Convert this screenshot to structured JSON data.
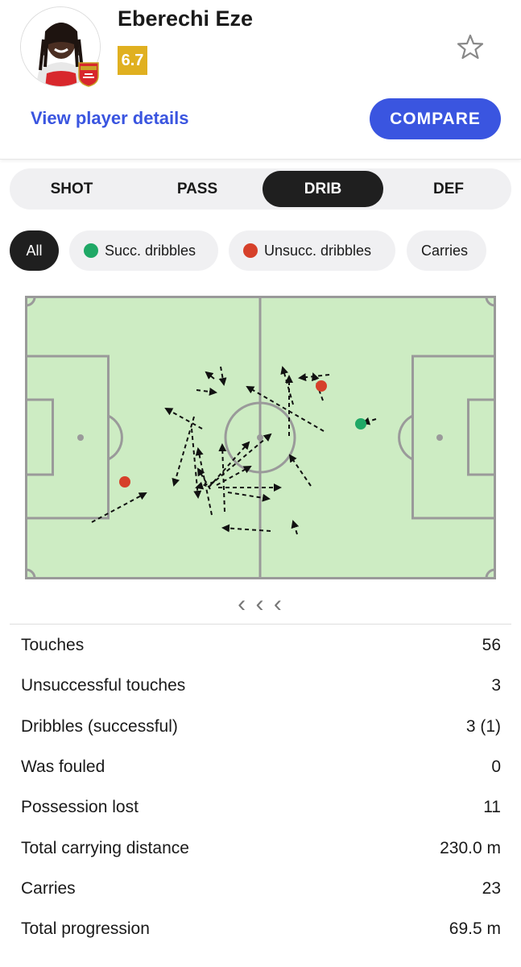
{
  "player": {
    "name": "Eberechi Eze",
    "rating": "6.7",
    "club_badge_text": "Arsenal"
  },
  "header": {
    "view_details": "View player details",
    "compare": "COMPARE"
  },
  "tabs": [
    "SHOT",
    "PASS",
    "DRIB",
    "DEF"
  ],
  "active_tab": "DRIB",
  "filters": {
    "all": "All",
    "succ": "Succ. dribbles",
    "unsucc": "Unsucc. dribbles",
    "carries": "Carries"
  },
  "colors": {
    "accent": "#3a55e0",
    "rating": "#e0b020",
    "pitch": "#cdecc3",
    "pitch_lines": "#999999",
    "success": "#1fa866",
    "fail": "#d6402a"
  },
  "nav_arrows": "‹ ‹ ‹",
  "stats": [
    {
      "label": "Touches",
      "value": "56"
    },
    {
      "label": "Unsuccessful touches",
      "value": "3"
    },
    {
      "label": "Dribbles (successful)",
      "value": "3 (1)"
    },
    {
      "label": "Was fouled",
      "value": "0"
    },
    {
      "label": "Possession lost",
      "value": "11"
    },
    {
      "label": "Total carrying distance",
      "value": "230.0 m"
    },
    {
      "label": "Carries",
      "value": "23"
    },
    {
      "label": "Total progression",
      "value": "69.5 m"
    }
  ]
}
